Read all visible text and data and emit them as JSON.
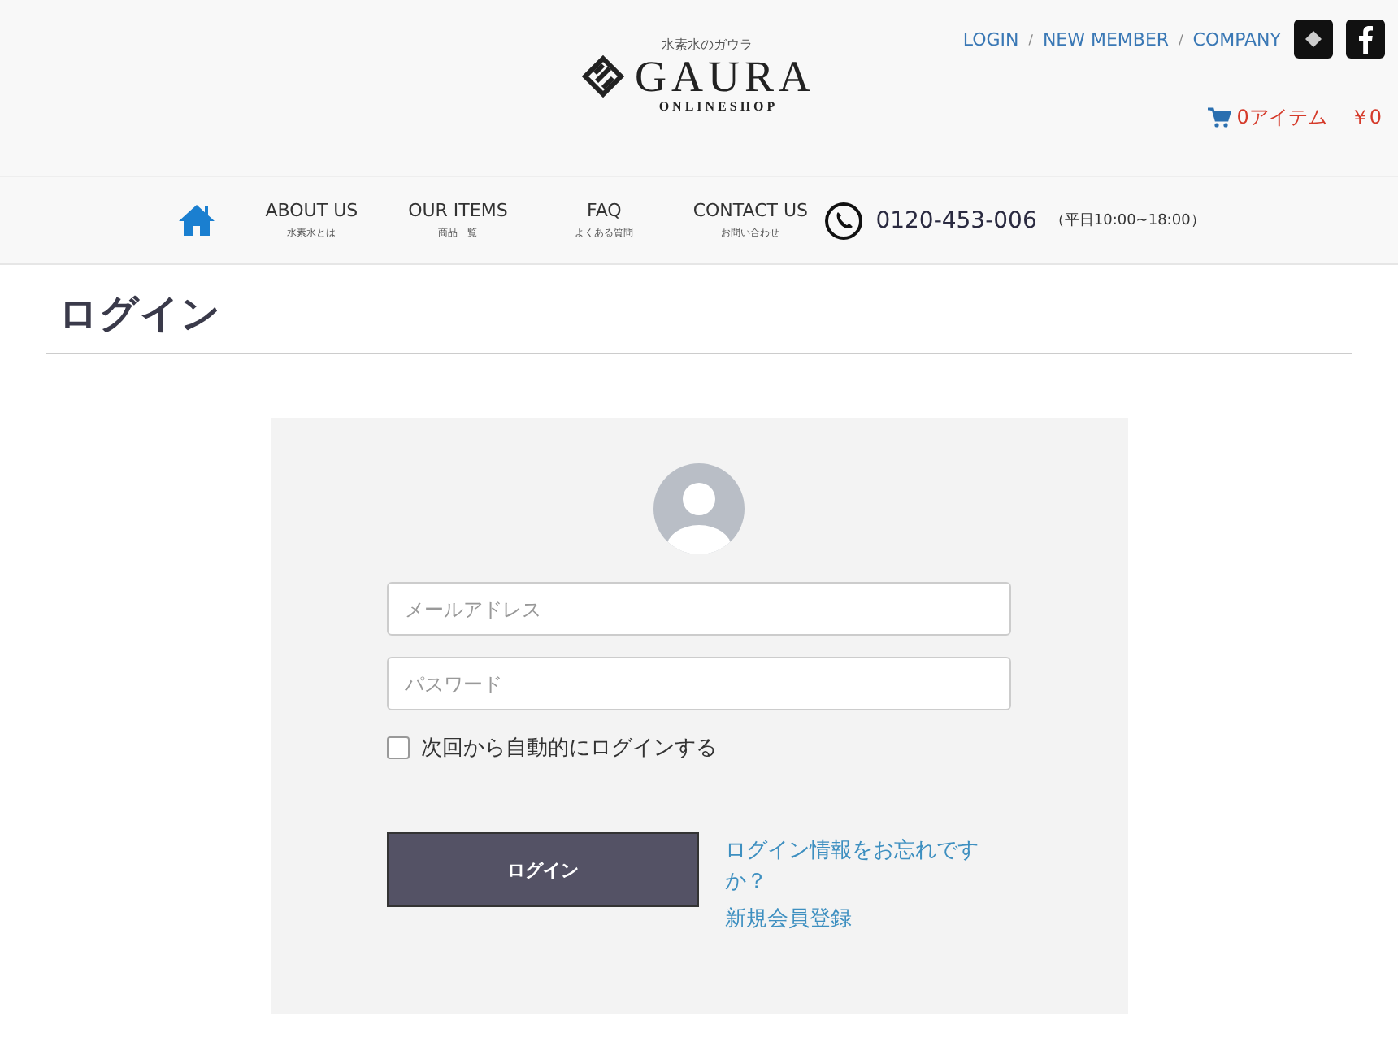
{
  "brand": {
    "tagline": "水素水のガウラ",
    "name": "GAURA",
    "sub": "ONLINESHOP"
  },
  "top_links": [
    {
      "label": "LOGIN"
    },
    {
      "label": "NEW MEMBER",
      "separator": "/"
    },
    {
      "label": "COMPANY",
      "separator": "/"
    }
  ],
  "cart": {
    "items": "0アイテム",
    "total": "￥0"
  },
  "nav": [
    {
      "label": "ABOUT US",
      "sub": "水素水とは"
    },
    {
      "label": "OUR ITEMS",
      "sub": "商品一覧"
    },
    {
      "label": "FAQ",
      "sub": "よくある質問"
    },
    {
      "label": "CONTACT US",
      "sub": "お問い合わせ"
    }
  ],
  "phone": {
    "number": "0120-453-006",
    "hours": "（平日10:00~18:00）"
  },
  "page_title": "ログイン",
  "form": {
    "email": {
      "placeholder": "メールアドレス"
    },
    "password": {
      "placeholder": "パスワード"
    },
    "remember": {
      "label": "次回から自動的にログインする",
      "checked": false
    },
    "submit": "ログイン",
    "forgot": "ログイン情報をお忘れですか？",
    "register": "新規会員登録"
  }
}
